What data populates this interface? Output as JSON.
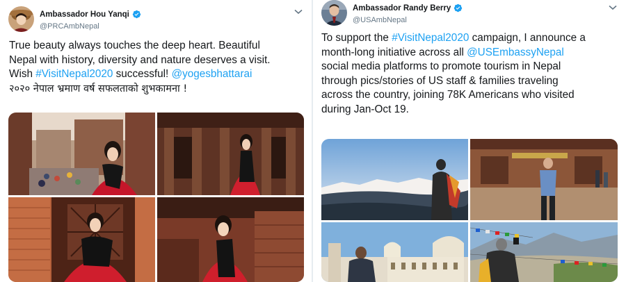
{
  "colors": {
    "link": "#1da1f2",
    "text": "#14171a",
    "secondary": "#657786",
    "verified": "#1da1f2"
  },
  "tweet_left": {
    "name": "Ambassador Hou Yanqi",
    "handle": "@PRCAmbNepal",
    "lines": [
      {
        "segments": [
          {
            "text": "True beauty always touches the deep heart.  Beautiful"
          }
        ]
      },
      {
        "segments": [
          {
            "text": "Nepal with history, diversity and nature deserves a visit."
          }
        ]
      },
      {
        "segments": [
          {
            "text": "Wish "
          },
          {
            "text": "#VisitNepal2020",
            "link": true
          },
          {
            "text": " successful! "
          },
          {
            "text": "@yogesbhattarai",
            "link": true
          }
        ]
      },
      {
        "segments": [
          {
            "text": "२०२० नेपाल भ्रमाण वर्ष सफलताको शुभकामना !"
          }
        ]
      }
    ],
    "photos_icon": "photo-icon"
  },
  "tweet_right": {
    "name": "Ambassador Randy Berry",
    "handle": "@USAmbNepal",
    "lines": [
      {
        "segments": [
          {
            "text": "To support the "
          },
          {
            "text": "#VisitNepal2020",
            "link": true
          },
          {
            "text": " campaign, I announce a"
          }
        ]
      },
      {
        "segments": [
          {
            "text": "month-long initiative across all "
          },
          {
            "text": "@USEmbassyNepal",
            "link": true
          }
        ]
      },
      {
        "segments": [
          {
            "text": "social media platforms to promote tourism in Nepal"
          }
        ]
      },
      {
        "segments": [
          {
            "text": "through pics/stories of US staff & families traveling"
          }
        ]
      },
      {
        "segments": [
          {
            "text": "across the country, joining 78K Americans who visited"
          }
        ]
      },
      {
        "segments": [
          {
            "text": "during Jan-Oct 19."
          }
        ]
      }
    ],
    "photos_icon": "photo-icon"
  },
  "icons": {
    "verified": "verified-badge-icon",
    "menu": "chevron-down-icon"
  }
}
